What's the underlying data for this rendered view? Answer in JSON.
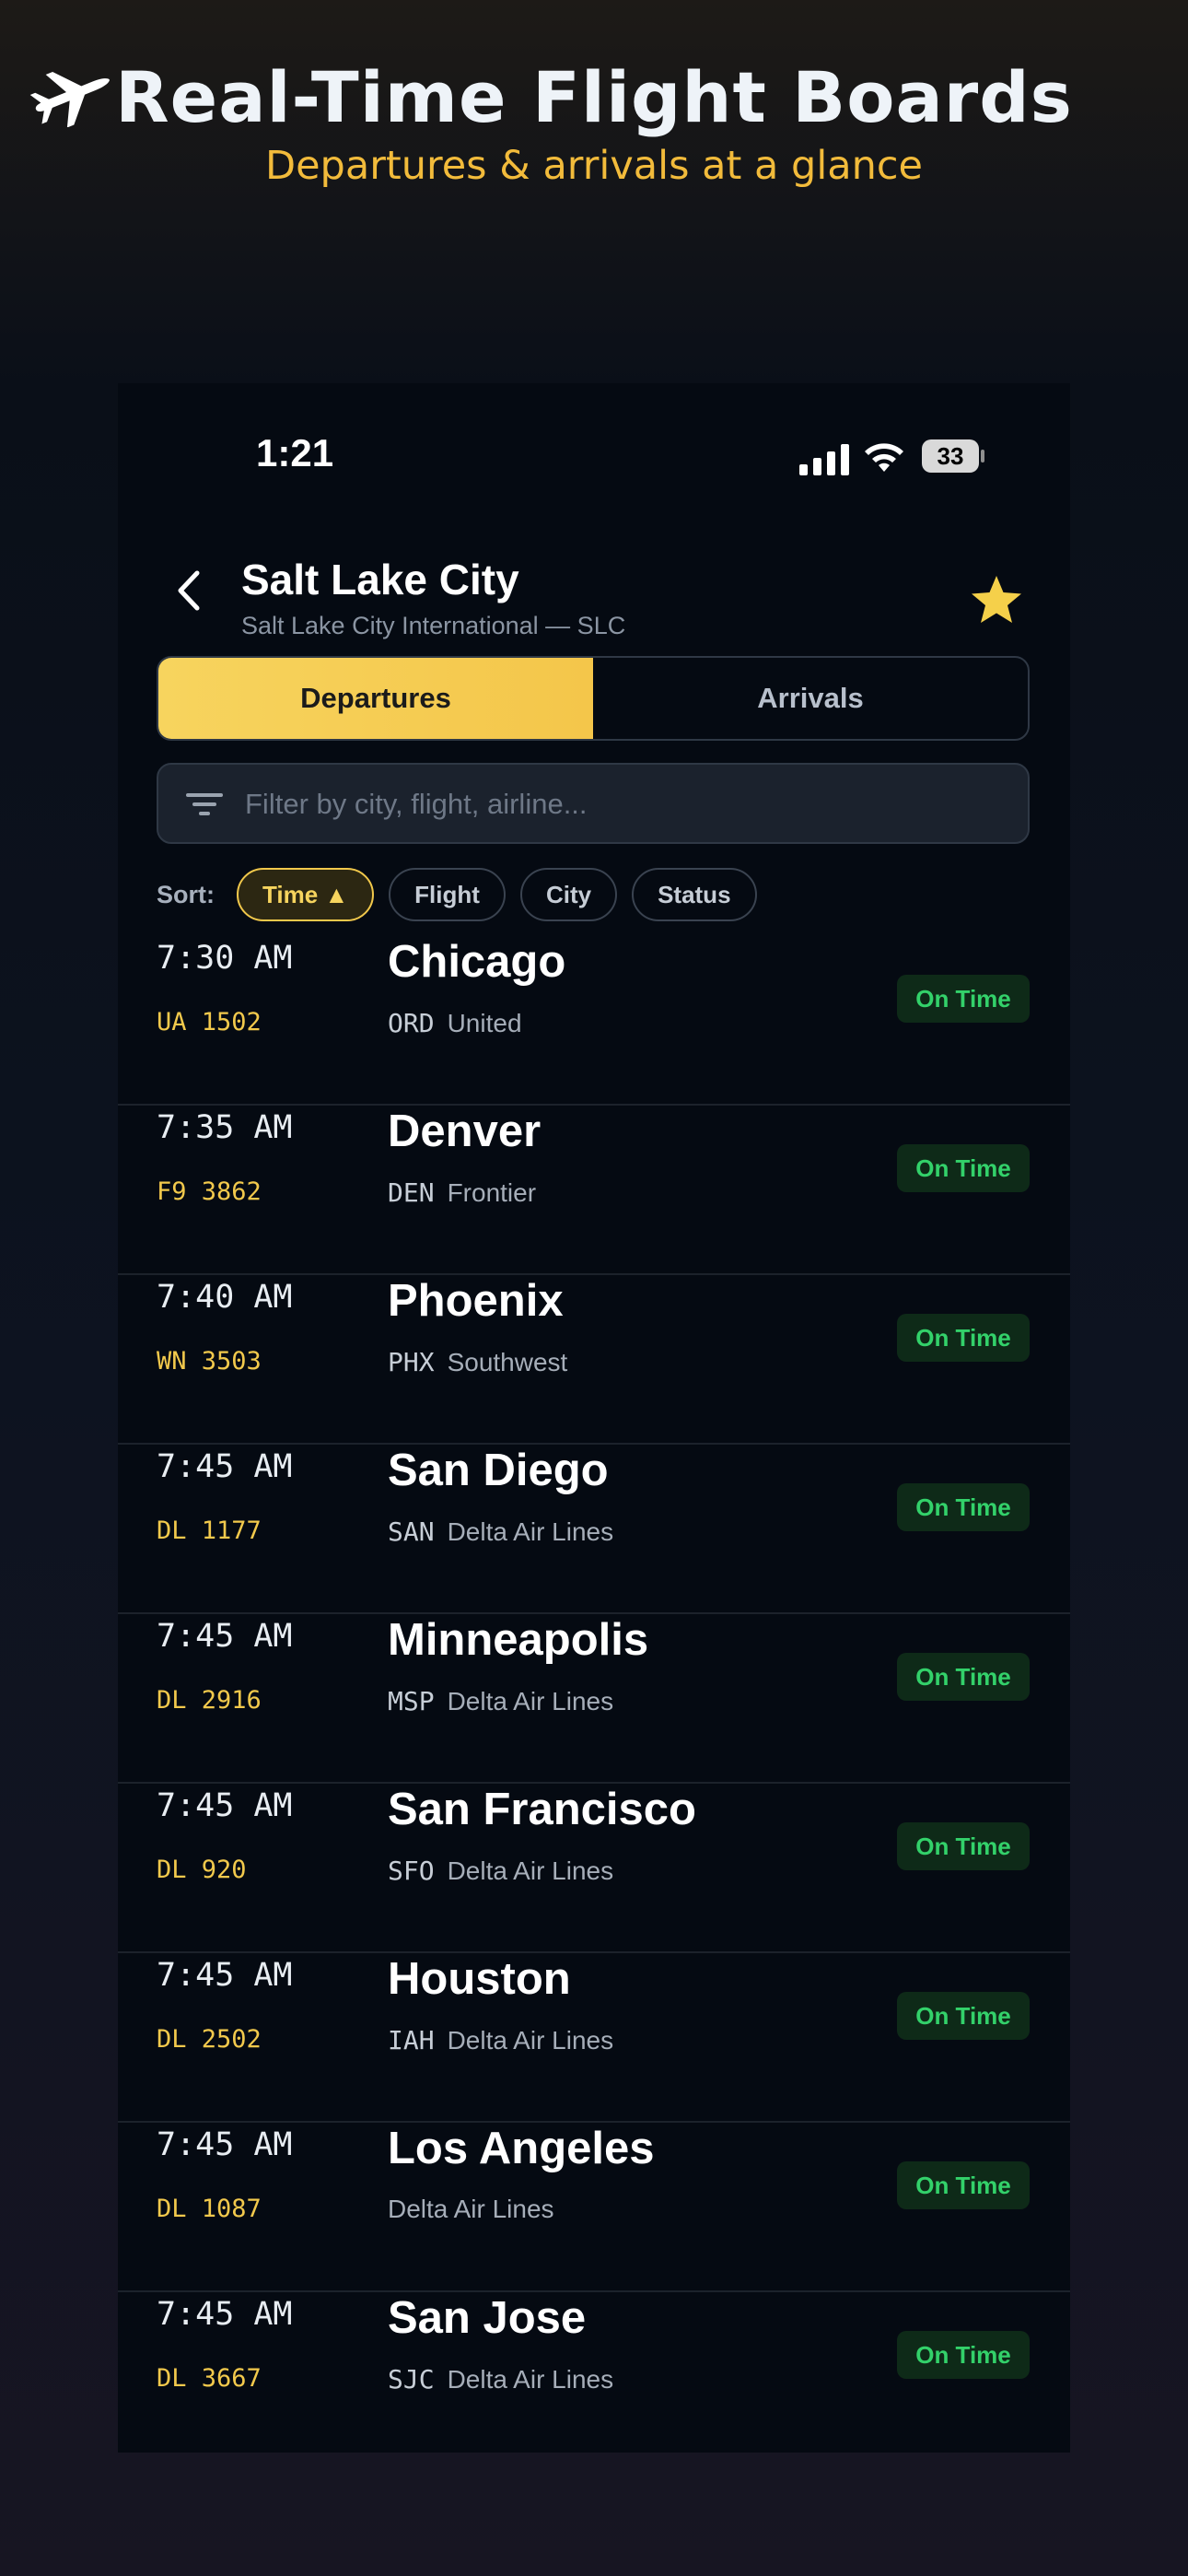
{
  "hero": {
    "title": "Real-Time Flight Boards",
    "subtitle": "Departures & arrivals at a glance"
  },
  "status_bar": {
    "time": "1:21",
    "battery": "33"
  },
  "header": {
    "title": "Salt Lake City",
    "subtitle": "Salt Lake City International — SLC"
  },
  "tabs": {
    "departures": "Departures",
    "arrivals": "Arrivals",
    "active": "Departures"
  },
  "filter": {
    "placeholder": "Filter by city, flight, airline..."
  },
  "sort": {
    "label": "Sort:",
    "options": [
      "Time ▲",
      "Flight",
      "City",
      "Status"
    ],
    "active": "Time ▲"
  },
  "colors": {
    "accent": "#f4c64a",
    "on_time": "#33d16a",
    "background": "#050a12"
  },
  "flights": [
    {
      "time": "7:30 AM",
      "flight": "UA 1502",
      "city": "Chicago",
      "code": "ORD",
      "airline": "United",
      "status": "On Time"
    },
    {
      "time": "7:35 AM",
      "flight": "F9 3862",
      "city": "Denver",
      "code": "DEN",
      "airline": "Frontier",
      "status": "On Time"
    },
    {
      "time": "7:40 AM",
      "flight": "WN 3503",
      "city": "Phoenix",
      "code": "PHX",
      "airline": "Southwest",
      "status": "On Time"
    },
    {
      "time": "7:45 AM",
      "flight": "DL 1177",
      "city": "San Diego",
      "code": "SAN",
      "airline": "Delta Air Lines",
      "status": "On Time"
    },
    {
      "time": "7:45 AM",
      "flight": "DL 2916",
      "city": "Minneapolis",
      "code": "MSP",
      "airline": "Delta Air Lines",
      "status": "On Time"
    },
    {
      "time": "7:45 AM",
      "flight": "DL 920",
      "city": "San Francisco",
      "code": "SFO",
      "airline": "Delta Air Lines",
      "status": "On Time"
    },
    {
      "time": "7:45 AM",
      "flight": "DL 2502",
      "city": "Houston",
      "code": "IAH",
      "airline": "Delta Air Lines",
      "status": "On Time"
    },
    {
      "time": "7:45 AM",
      "flight": "DL 1087",
      "city": "Los Angeles",
      "code": "",
      "airline": "Delta Air Lines",
      "status": "On Time"
    },
    {
      "time": "7:45 AM",
      "flight": "DL 3667",
      "city": "San Jose",
      "code": "SJC",
      "airline": "Delta Air Lines",
      "status": "On Time"
    }
  ]
}
